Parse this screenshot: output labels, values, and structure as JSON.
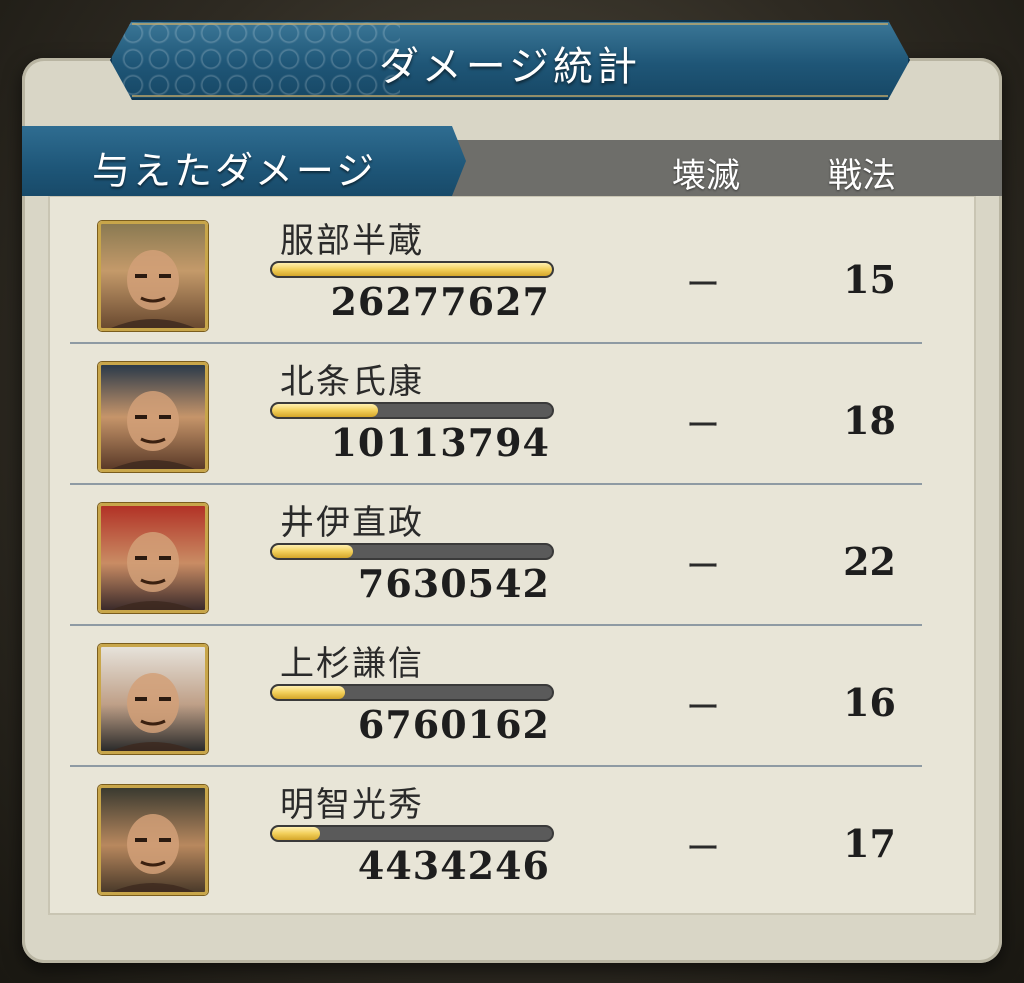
{
  "title": "ダメージ統計",
  "section_tab": "与えたダメージ",
  "columns": {
    "destroy": "壊滅",
    "tactic": "戦法"
  },
  "rows": [
    {
      "name": "服部半蔵",
      "damage": "26277627",
      "bar_fraction": 1.0,
      "destroy": "ー",
      "tactic": "15",
      "portrait": "hattori-hanzo-portrait"
    },
    {
      "name": "北条氏康",
      "damage": "10113794",
      "bar_fraction": 0.38,
      "destroy": "ー",
      "tactic": "18",
      "portrait": "hojo-ujiyasu-portrait"
    },
    {
      "name": "井伊直政",
      "damage": "7630542",
      "bar_fraction": 0.29,
      "destroy": "ー",
      "tactic": "22",
      "portrait": "ii-naomasa-portrait"
    },
    {
      "name": "上杉謙信",
      "damage": "6760162",
      "bar_fraction": 0.26,
      "destroy": "ー",
      "tactic": "16",
      "portrait": "uesugi-kenshin-portrait"
    },
    {
      "name": "明智光秀",
      "damage": "4434246",
      "bar_fraction": 0.17,
      "destroy": "ー",
      "tactic": "17",
      "portrait": "akechi-mitsuhide-portrait"
    }
  ],
  "colors": {
    "banner": "#1f5677",
    "bar_fill": "#f2cf5a",
    "frame_gold": "#c8a64a"
  }
}
